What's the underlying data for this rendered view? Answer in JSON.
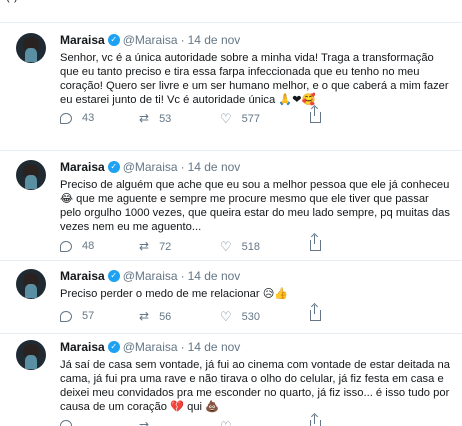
{
  "top_fragment": "(*)…",
  "tweets": [
    {
      "name": "Maraisa",
      "handle": "@Maraisa",
      "separator": "·",
      "date": "14 de nov",
      "text": "Senhor, vc é a única autoridade sobre a minha vida! Traga a transformação que eu tanto preciso e tira essa farpa infeccionada que eu tenho no meu coração! Quero ser livre e um ser humano melhor, e o que caberá a mim fazer eu estarei junto de ti! Vc é autoridade única 🙏❤🥰",
      "replies": "43",
      "retweets": "53",
      "likes": "577"
    },
    {
      "name": "Maraisa",
      "handle": "@Maraisa",
      "separator": "·",
      "date": "14 de nov",
      "text": "Preciso de alguém que ache que eu sou a melhor pessoa que ele já conheceu 😂 que me aguente e sempre me procure mesmo que ele tiver que passar pelo orgulho 1000 vezes, que queira estar do meu lado sempre, pq muitas das vezes nem eu me aguento...",
      "replies": "48",
      "retweets": "72",
      "likes": "518"
    },
    {
      "name": "Maraisa",
      "handle": "@Maraisa",
      "separator": "·",
      "date": "14 de nov",
      "text": "Preciso perder o medo de me relacionar 😥👍",
      "replies": "57",
      "retweets": "56",
      "likes": "530"
    },
    {
      "name": "Maraisa",
      "handle": "@Maraisa",
      "separator": "·",
      "date": "14 de nov",
      "text": "Já saí de casa sem vontade, já fui ao cinema com vontade de estar deitada na cama, já fui pra uma rave e não tirava o olho do celular, já fiz festa em casa e deixei meu convidados pra me esconder no quarto, já fiz isso... é isso tudo por causa de um coração 💔 qui 💩",
      "replies": "",
      "retweets": "",
      "likes": ""
    }
  ],
  "icons": {
    "verified": "verified-badge-icon",
    "reply": "reply-icon",
    "retweet": "retweet-icon",
    "like": "like-icon",
    "share": "share-icon"
  },
  "colors": {
    "text": "#14171a",
    "muted": "#657786",
    "verified": "#1da1f2",
    "divider": "#e6ecf0"
  }
}
